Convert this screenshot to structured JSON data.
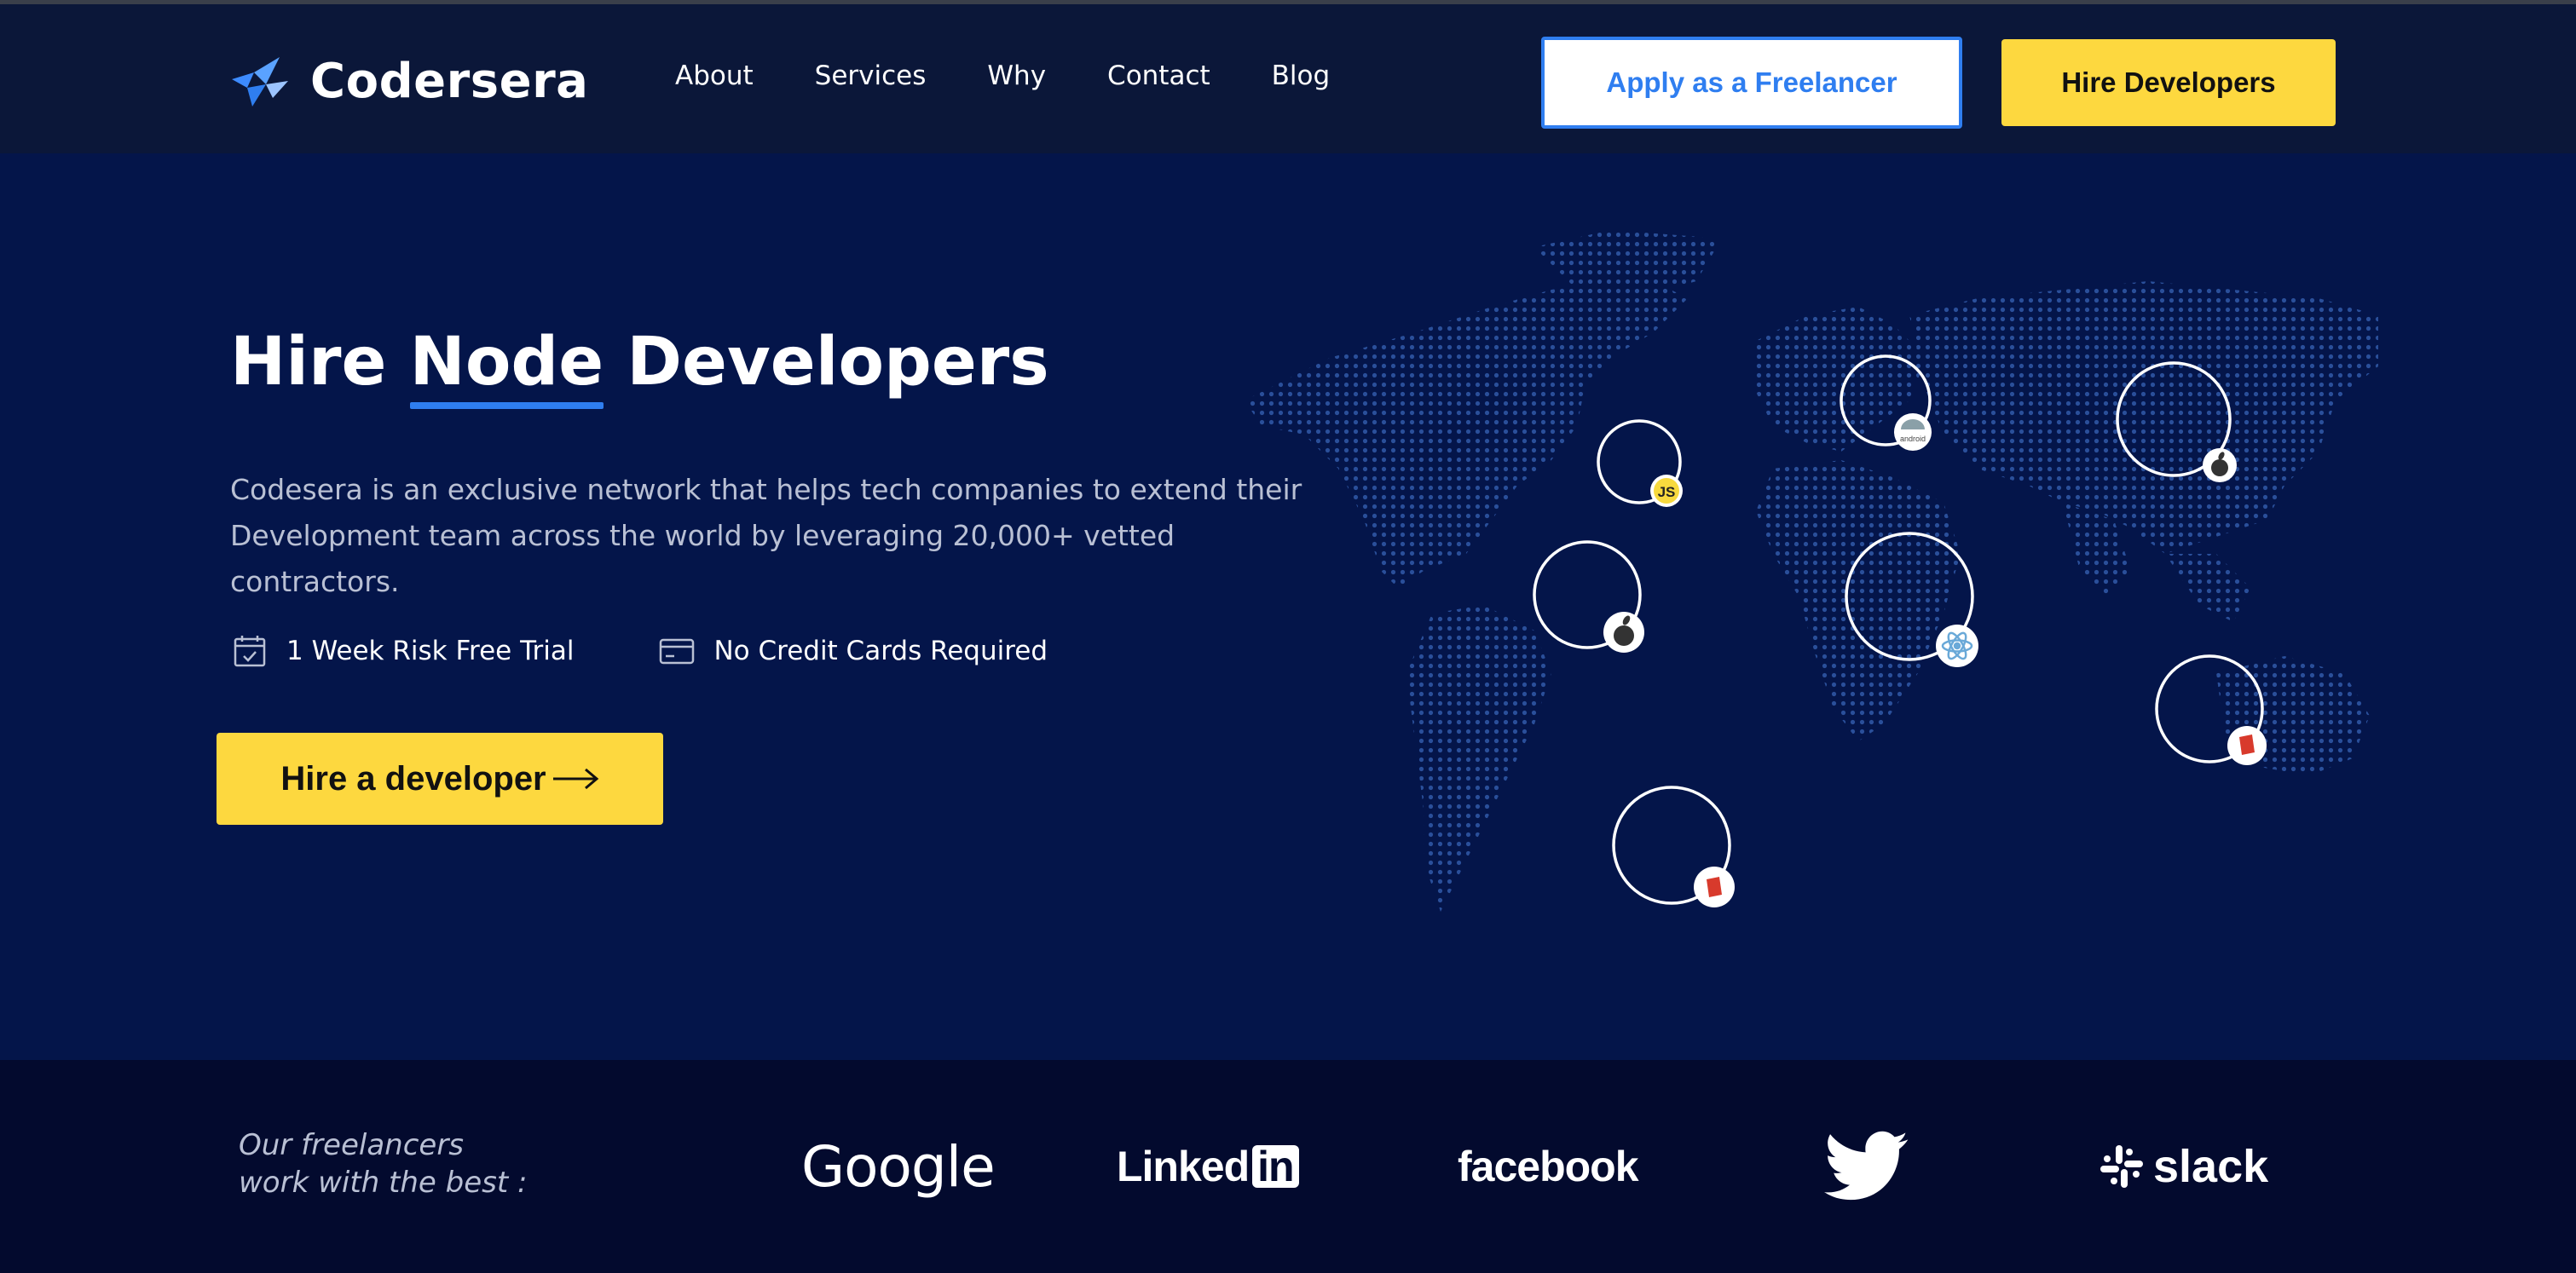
{
  "header": {
    "logo_text": "Codersera",
    "nav": [
      "About",
      "Services",
      "Why",
      "Contact",
      "Blog"
    ],
    "apply_label": "Apply as a Freelancer",
    "hire_label": "Hire Developers"
  },
  "hero": {
    "title_before": "Hire ",
    "title_highlight": "Node",
    "title_after": " Developers",
    "description": "Codesera is an exclusive network that helps tech companies to extend their Development team across the world by leveraging 20,000+ vetted contractors.",
    "features": [
      "1 Week Risk Free Trial",
      "No Credit Cards Required"
    ],
    "cta_label": "Hire a developer",
    "map_badges": [
      "JS",
      "android",
      "apple-icon",
      "apple-icon",
      "react-icon",
      "flag-icon",
      "flag-icon"
    ]
  },
  "partners": {
    "label_line1": "Our freelancers",
    "label_line2": "work with the best :",
    "logos": [
      "Google",
      "Linked",
      "in",
      "facebook",
      "twitter-icon",
      "slack"
    ]
  },
  "colors": {
    "accent_blue": "#2f7ef0",
    "accent_yellow": "#fdd83f",
    "hero_bg": "#04154a",
    "header_bg": "#0b1739",
    "partners_bg": "#030a2e"
  }
}
